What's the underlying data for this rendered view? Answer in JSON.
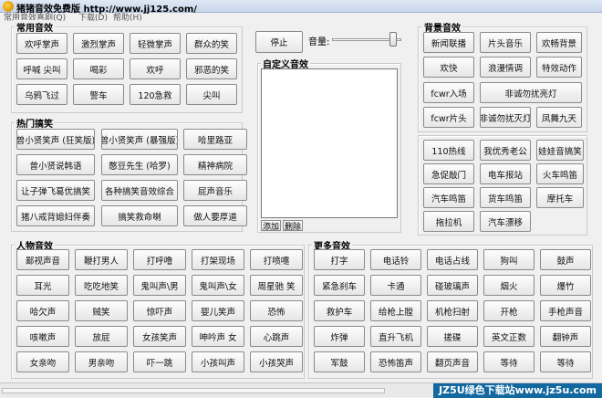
{
  "window": {
    "title": "猪猪音效免费版 http://www.jj125.com/"
  },
  "menu": [
    "常用音效",
    "喜剧(Q)",
    "下载(D)",
    "帮助(H)"
  ],
  "groups": {
    "common": {
      "title": "常用音效",
      "buttons": [
        "欢呼掌声",
        "激烈掌声",
        "轻微掌声",
        "群众的笑",
        "呼喊 尖叫",
        "喝彩",
        "欢呼",
        "邪恶的笑",
        "乌鸦飞过",
        "警车",
        "120急救",
        "尖叫"
      ]
    },
    "funny": {
      "title": "热门搞笑",
      "buttons": [
        "曾小贤笑声 (狂笑版)",
        "曾小贤笑声 (暴强版)",
        "哈里路亚",
        "曾小贤说韩语",
        "憨豆先生 (哈罗)",
        "精神病院",
        "让子弹飞葛优搞笑",
        "各种搞笑音效综合",
        "屁声音乐",
        "猪八戒背媳妇伴奏",
        "搞笑救命喇",
        "做人要厚道"
      ]
    },
    "people": {
      "title": "人物音效",
      "buttons": [
        "鄙视声音",
        "鞭打男人",
        "打呼噜",
        "打架现场",
        "打喷嚏",
        "耳光",
        "吃吃地笑",
        "鬼叫声\\男",
        "鬼叫声\\女",
        "周星驰 笑",
        "哈欠声",
        "贼笑",
        "惊吓声",
        "婴儿笑声",
        "恐怖",
        "咳嗽声",
        "放屁",
        "女孩笑声",
        "呻吟声 女",
        "心跳声",
        "女亲吻",
        "男亲吻",
        "吓一跳",
        "小孩叫声",
        "小孩哭声"
      ]
    },
    "custom": {
      "title": "自定义音效",
      "add": "添加",
      "delete": "删除"
    },
    "more": {
      "title": "更多音效",
      "buttons": [
        "打字",
        "电话铃",
        "电话占线",
        "狗叫",
        "鼓声",
        "紧急刹车",
        "卡通",
        "碰玻璃声",
        "烟火",
        "爆竹",
        "救护车",
        "给枪上膛",
        "机枪扫射",
        "开枪",
        "手枪声音",
        "炸弹",
        "直升飞机",
        "搓碟",
        "英文正数",
        "翻钟声",
        "军鼓",
        "恐怖笛声",
        "翻页声音",
        "等待",
        "等待"
      ]
    },
    "bg": {
      "title": "背景音效",
      "buttons": [
        "新闻联播",
        "片头音乐",
        "欢畅背景",
        "欢快",
        "浪漫情调",
        "特效动作",
        "fcwr入场",
        "非诚勿扰亮灯",
        "fcwr片头",
        "非诚勿扰灭灯",
        "凤舞九天"
      ]
    },
    "vehicle": {
      "buttons": [
        "110热线",
        "我优秀老公",
        "娃娃音搞笑",
        "急促敲门",
        "电车报站",
        "火车鸣笛",
        "汽车鸣笛",
        "货车鸣笛",
        "摩托车",
        "拖拉机",
        "汽车漂移"
      ]
    }
  },
  "controls": {
    "stop": "停止",
    "volume_label": "音量:",
    "volume": 0.92
  },
  "status": {
    "watermark": "JZ5U绿色下载站www.jz5u.com"
  }
}
